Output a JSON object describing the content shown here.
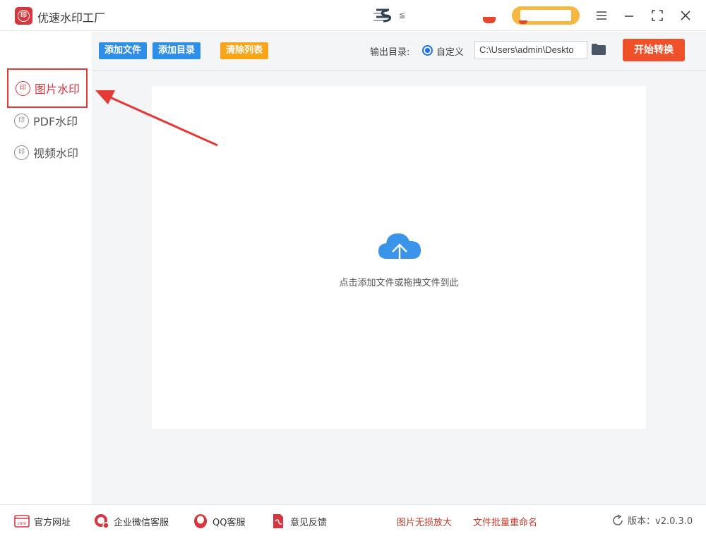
{
  "app": {
    "title": "优速水印工厂",
    "logo_glyph": "印"
  },
  "titlebar": {
    "promo_text": "≦",
    "icons": [
      "menu-icon",
      "minimize-icon",
      "maximize-icon",
      "close-icon"
    ]
  },
  "sidebar": {
    "items": [
      {
        "label": "图片水印",
        "glyph": "印",
        "active": true
      },
      {
        "label": "PDF水印",
        "glyph": "印",
        "active": false
      },
      {
        "label": "视频水印",
        "glyph": "印",
        "active": false
      }
    ]
  },
  "toolbar": {
    "add_file": "添加文件",
    "add_dir": "添加目录",
    "clear_list": "清除列表",
    "output_label": "输出目录:",
    "radio_label": "自定义",
    "output_path": "C:\\Users\\admin\\Deskto",
    "start_button": "开始转换"
  },
  "dropzone": {
    "hint": "点击添加文件或拖拽文件到此"
  },
  "footer": {
    "website": "官方网址",
    "wechat": "企业微信客服",
    "qq": "QQ客服",
    "feedback": "意见反馈",
    "link1": "图片无损放大",
    "link2": "文件批量重命名",
    "version": "版本：v2.0.3.0",
    "website_icon_text": "com"
  },
  "colors": {
    "accent_red": "#d9353f",
    "blue_button": "#2f8ee8",
    "orange_button": "#f7a61b",
    "start_button": "#f0512b",
    "cloud": "#3a95ea"
  }
}
